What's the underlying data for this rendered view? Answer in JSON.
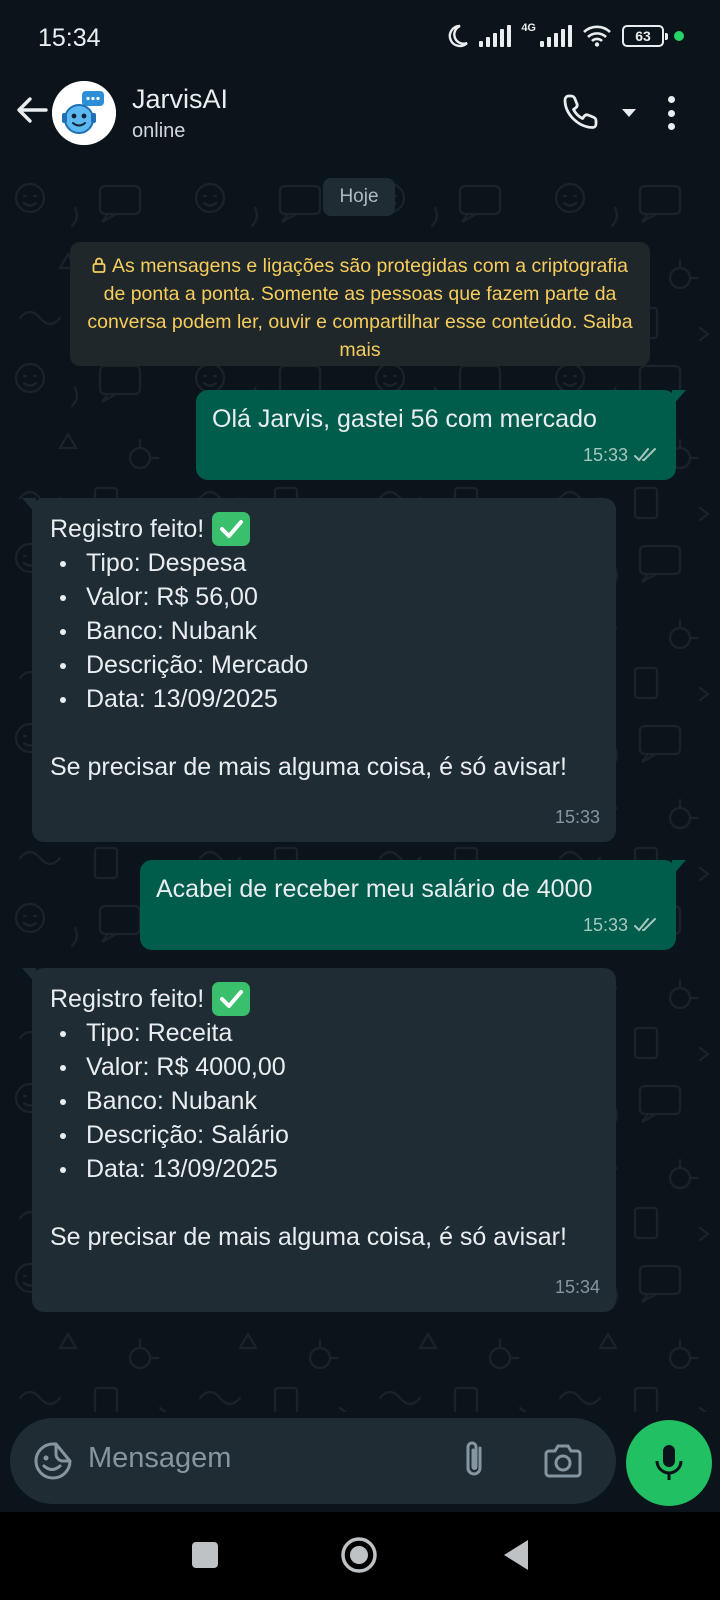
{
  "status_bar": {
    "time": "15:34",
    "network": "4G",
    "battery": "63"
  },
  "header": {
    "title": "JarvisAI",
    "subtitle": "online"
  },
  "chat": {
    "date_chip": "Hoje",
    "encryption_notice": "As mensagens e ligações são protegidas com a criptografia de ponta a ponta. Somente as pessoas que fazem parte da conversa podem ler, ouvir e compartilhar esse conteúdo. Saiba mais",
    "messages": [
      {
        "direction": "out",
        "text": "Olá Jarvis, gastei 56 com mercado",
        "time": "15:33"
      },
      {
        "direction": "in",
        "heading": "Registro feito!",
        "items": [
          "Tipo: Despesa",
          "Valor: R$ 56,00",
          "Banco: Nubank",
          "Descrição: Mercado",
          "Data: 13/09/2025"
        ],
        "footer": "Se precisar de mais alguma coisa, é só avisar!",
        "time": "15:33"
      },
      {
        "direction": "out",
        "text": "Acabei de receber meu salário de 4000",
        "time": "15:33"
      },
      {
        "direction": "in",
        "heading": "Registro feito!",
        "items": [
          "Tipo: Receita",
          "Valor: R$ 4000,00",
          "Banco: Nubank",
          "Descrição: Salário",
          "Data: 13/09/2025"
        ],
        "footer": "Se precisar de mais alguma coisa, é só avisar!",
        "time": "15:34"
      }
    ]
  },
  "input": {
    "placeholder": "Mensagem"
  },
  "colors": {
    "background": "#0b141a",
    "outgoing_bubble": "#005c4b",
    "incoming_bubble": "#1f2c34",
    "accent_green": "#21c063",
    "notice_text": "#f7cd5b"
  },
  "icons": {
    "back": "arrow-left-icon",
    "call": "phone-icon",
    "menu": "more-vertical-icon",
    "emoji": "sticker-icon",
    "attach": "paperclip-icon",
    "camera": "camera-icon",
    "mic": "mic-icon"
  }
}
